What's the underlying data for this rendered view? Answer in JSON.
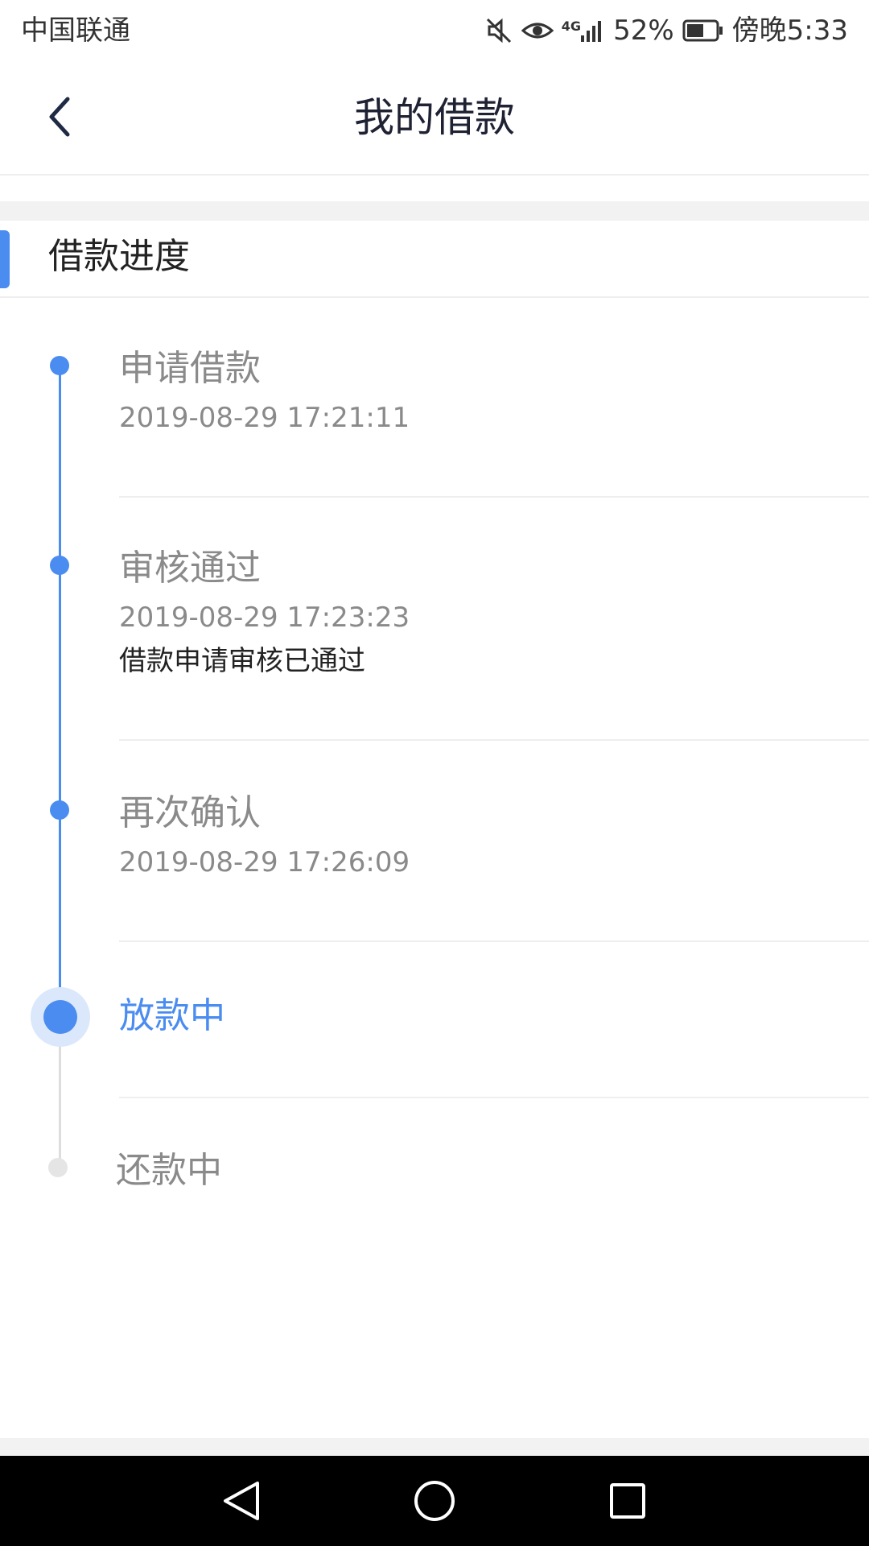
{
  "status_bar": {
    "carrier": "中国联通",
    "network": "4G",
    "battery": "52%",
    "time": "傍晚5:33",
    "icons": [
      "mute-icon",
      "eye-icon",
      "signal-icon",
      "battery-icon"
    ]
  },
  "header": {
    "title": "我的借款",
    "back_icon": "chevron-left-icon"
  },
  "section": {
    "title": "借款进度"
  },
  "timeline": [
    {
      "title": "申请借款",
      "time": "2019-08-29 17:21:11",
      "note": "",
      "state": "done"
    },
    {
      "title": "审核通过",
      "time": "2019-08-29 17:23:23",
      "note": "借款申请审核已通过",
      "state": "done"
    },
    {
      "title": "再次确认",
      "time": "2019-08-29 17:26:09",
      "note": "",
      "state": "done"
    },
    {
      "title": "放款中",
      "time": "",
      "note": "",
      "state": "current"
    },
    {
      "title": "还款中",
      "time": "",
      "note": "",
      "state": "pending"
    }
  ],
  "nav_bar": {
    "icons": [
      "back-triangle-icon",
      "home-circle-icon",
      "recents-square-icon"
    ]
  },
  "colors": {
    "accent": "#4a8cf0",
    "muted_text": "#8a8a8a",
    "pending": "#e5e5e5"
  }
}
